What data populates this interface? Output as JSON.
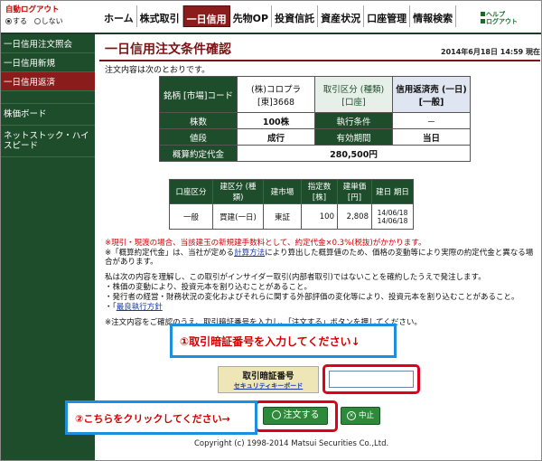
{
  "autologout": {
    "title": "自動ログアウト",
    "on": "する",
    "off": "しない"
  },
  "nav": [
    "ホーム",
    "株式取引",
    "一日信用",
    "先物OP",
    "投資信託",
    "資産状況",
    "口座管理",
    "情報検索"
  ],
  "help": {
    "line1": "ヘルプ",
    "line2": "ログアウト"
  },
  "sidebar": {
    "items": [
      "一日信用注文照会",
      "一日信用新規",
      "一日信用返済"
    ],
    "board": "株価ボード",
    "netstock": "ネットストック・ハイスピード"
  },
  "page": {
    "title": "一日信用注文条件確認",
    "date": "2014年6月18日 14:59 現在",
    "intro": "注文内容は次のとおりです。"
  },
  "order": {
    "stock_label": "銘柄 [市場]コード",
    "stock_name": "(株)コロプラ",
    "stock_code": "[東]3668",
    "trade_type_label": "取引区分 (種類) [口座]",
    "trade_type": "信用返済売 (一日) [一般]",
    "qty_label": "株数",
    "qty": "100株",
    "cond_label": "執行条件",
    "cond": "－",
    "price_label": "値段",
    "price": "成行",
    "expiry_label": "有効期間",
    "expiry": "当日",
    "estimate_label": "概算約定代金",
    "estimate": "280,500円"
  },
  "position": {
    "headers": [
      "口座区分",
      "建区分 (種類)",
      "建市場",
      "指定数 [株]",
      "建単価 [円]",
      "建日 期日"
    ],
    "row": [
      "一般",
      "買建(一日)",
      "東証",
      "100",
      "2,808",
      "14/06/18 14/06/18"
    ]
  },
  "notes": {
    "n1": "※現引・現渡の場合、当該建玉の新規建手数料として、約定代金×0.3%(税抜)がかかります。",
    "n2a": "※「概算約定代金」は、当社が定める",
    "n2link": "計算方法",
    "n2b": "により算出した概算値のため、価格の変動等により実際の約定代金と異なる場合があります。",
    "n3": "私は次の内容を理解し、この取引がインサイダー取引(内部者取引)ではないことを確約したうえで発注します。",
    "n4": "・株価の変動により、投資元本を割り込むことがあること。",
    "n5": "・発行者の経営・財務状況の変化およびそれらに関する外部評価の変化等により、投資元本を割り込むことがあること。",
    "n6a": "・「",
    "n6link": "最良執行方針",
    "n7": "※注文内容をご確認のうえ、取引暗証番号を入力し、「注文する」ボタンを押してください。"
  },
  "pin": {
    "label": "取引暗証番号",
    "keyboard": "セキュリティキーボード",
    "value": ""
  },
  "buttons": {
    "order": "注文する",
    "cancel": "中止"
  },
  "callouts": {
    "c1": "①取引暗証番号を入力してください↓",
    "c2": "②こちらをクリックしてください→"
  },
  "footer": "Copyright (c) 1998-2014 Matsui Securities Co.,Ltd.",
  "colors": {
    "brand_green": "#1e4d2b",
    "active_red": "#8a1c1c",
    "callout_blue": "#1e8fe0",
    "highlight_red": "#e0001a"
  }
}
